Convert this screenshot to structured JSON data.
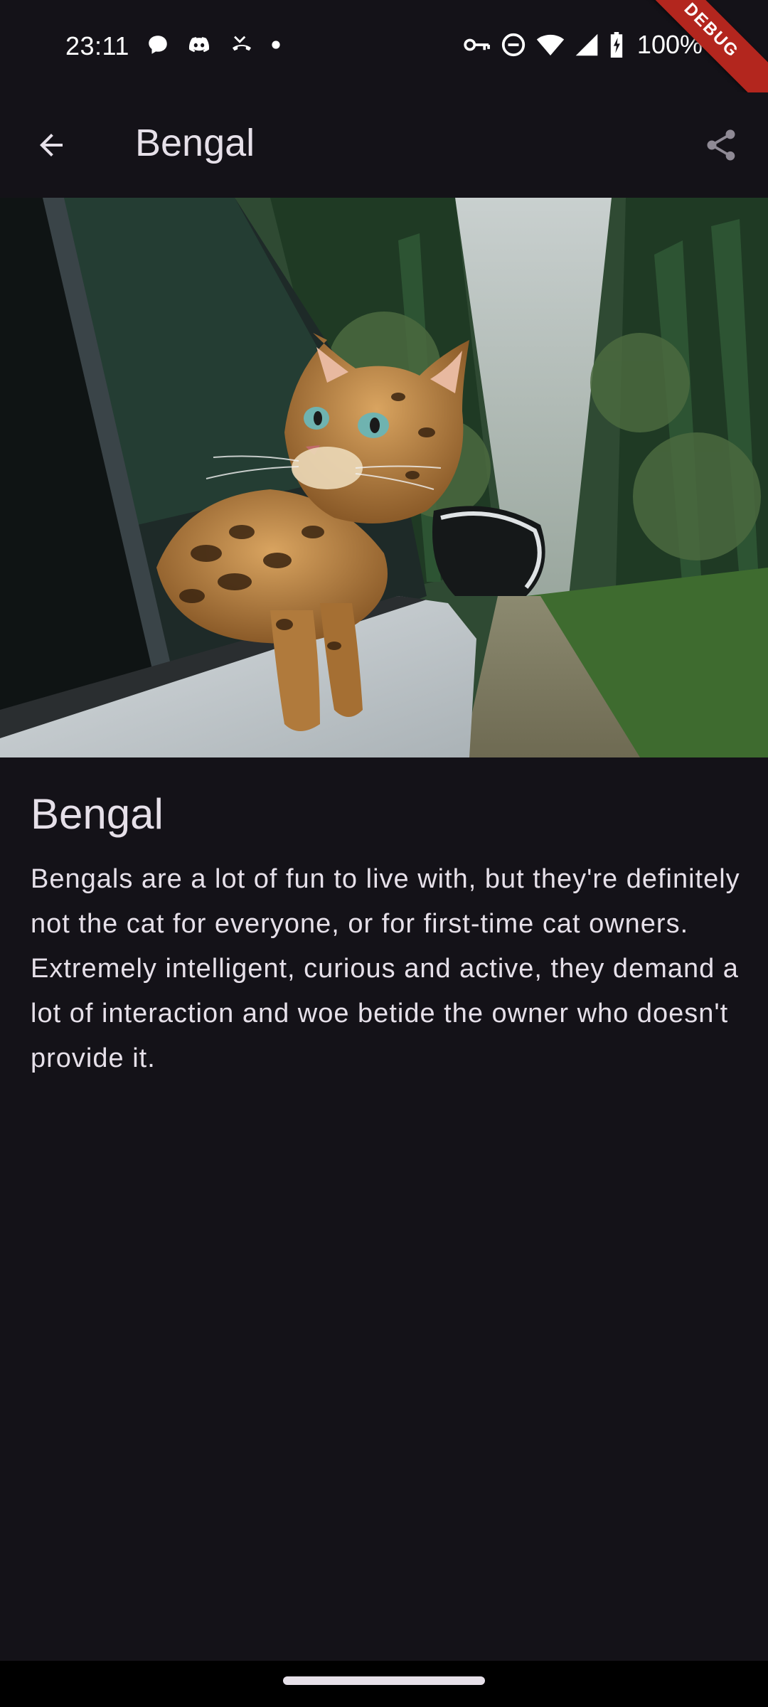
{
  "status_bar": {
    "time": "23:11",
    "left_icons": [
      "chat-bubble-icon",
      "discord-icon",
      "missed-call-icon",
      "dot-icon"
    ],
    "right_icons": [
      "vpn-key-icon",
      "do-not-disturb-icon",
      "wifi-icon",
      "signal-icon",
      "battery-charging-icon"
    ],
    "battery": "100%",
    "debug_label": "DEBUG"
  },
  "app_bar": {
    "back_icon": "arrow-back-icon",
    "title": "Bengal",
    "share_icon": "share-icon"
  },
  "breed": {
    "name": "Bengal",
    "description": "Bengals are a lot of fun to live with, but they're definitely not the cat for everyone, or for first-time cat owners. Extremely intelligent, curious and active, they demand a lot of interaction and woe betide the owner who doesn't provide it."
  },
  "colors": {
    "background": "#141218",
    "on_surface": "#E6E0E9",
    "debug_banner": "#B3261E"
  }
}
